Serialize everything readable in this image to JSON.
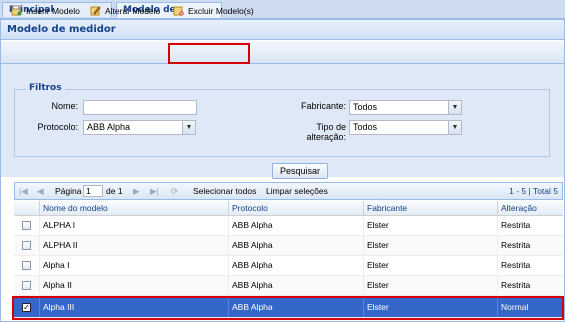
{
  "tabs": [
    {
      "label": "Principal"
    },
    {
      "label": "Modelo de medidor",
      "close": "✕"
    }
  ],
  "panel": {
    "title": "Modelo de medidor"
  },
  "toolbar": {
    "insert_label": "Inserir Modelo",
    "edit_label": "Alterar Modelo",
    "delete_label": "Excluir Modelo(s)"
  },
  "filters": {
    "legend": "Filtros",
    "nome_label": "Nome:",
    "nome_value": "",
    "protocolo_label": "Protocolo:",
    "protocolo_value": "ABB Alpha",
    "fabricante_label": "Fabricante:",
    "fabricante_value": "Todos",
    "tipo_label_1": "Tipo de",
    "tipo_label_2": "alteração:",
    "tipo_value": "Todos"
  },
  "search_button": "Pesquisar",
  "pager": {
    "page_label": "Página",
    "page_value": "1",
    "of_label": "de 1",
    "select_all": "Selecionar todos",
    "clear_selection": "Limpar seleções",
    "summary": "1 - 5 | Total 5"
  },
  "grid": {
    "columns": [
      "Nome do modelo",
      "Protocolo",
      "Fabricante",
      "Alteração"
    ],
    "rows": [
      {
        "name": "ALPHA I",
        "protocol": "ABB Alpha",
        "maker": "Elster",
        "change": "Restrita",
        "checked": false
      },
      {
        "name": "ALPHA II",
        "protocol": "ABB Alpha",
        "maker": "Elster",
        "change": "Restrita",
        "checked": false
      },
      {
        "name": "Alpha I",
        "protocol": "ABB Alpha",
        "maker": "Elster",
        "change": "Restrita",
        "checked": false
      },
      {
        "name": "Alpha II",
        "protocol": "ABB Alpha",
        "maker": "Elster",
        "change": "Restrita",
        "checked": false
      },
      {
        "name": "Alpha III",
        "protocol": "ABB Alpha",
        "maker": "Elster",
        "change": "Normal",
        "checked": true
      }
    ]
  },
  "colors": {
    "accent": "#15428b",
    "selected_row": "#3566c9",
    "highlight": "#d40000"
  }
}
